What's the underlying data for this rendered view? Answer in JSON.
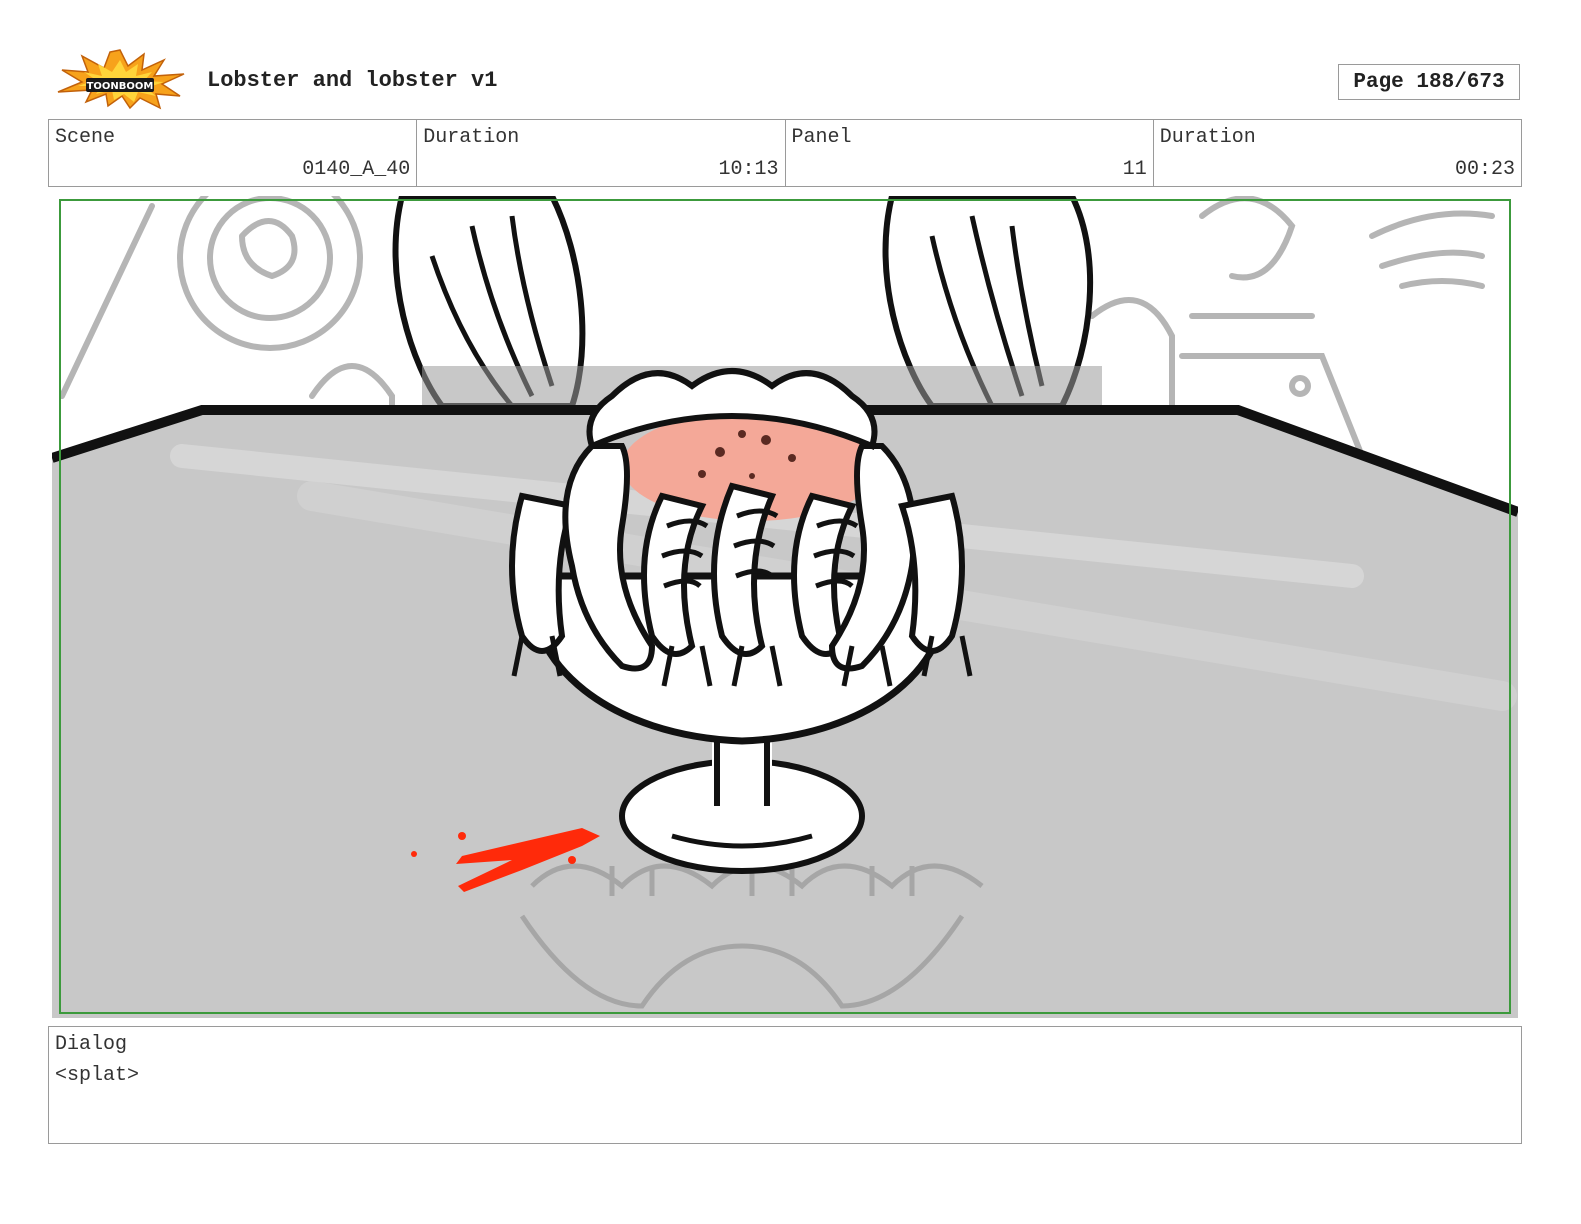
{
  "header": {
    "logo_text": "TOONBOOM",
    "title": "Lobster and lobster v1",
    "page": "Page 188/673"
  },
  "info": {
    "scene_label": "Scene",
    "scene_value": "0140_A_40",
    "duration_label": "Duration",
    "duration_value": "10:13",
    "panel_label": "Panel",
    "panel_value": "11",
    "panel_duration_label": "Duration",
    "panel_duration_value": "00:23"
  },
  "dialog": {
    "label": "Dialog",
    "text": "<splat>"
  },
  "colors": {
    "panel_border": "#3c9a3c",
    "splat": "#ff2a0a",
    "sauce": "#f4a898",
    "table": "#c8c8c8"
  }
}
